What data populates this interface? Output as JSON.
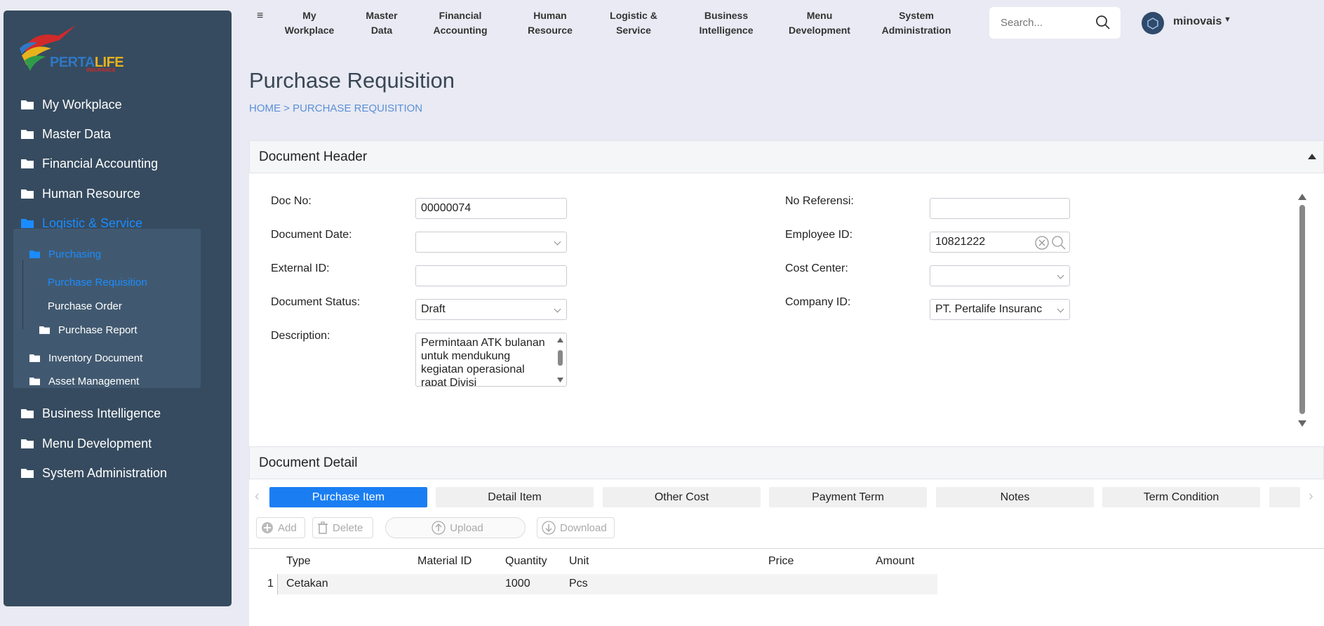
{
  "logo": {
    "brand_part1": "PERTA",
    "brand_part2": "LIFE",
    "tagline": "INSURANCE"
  },
  "sidebar": {
    "items": [
      {
        "label": "My Workplace"
      },
      {
        "label": "Master Data"
      },
      {
        "label": "Financial Accounting"
      },
      {
        "label": "Human Resource"
      },
      {
        "label": "Logistic & Service"
      },
      {
        "label": "Business Intelligence"
      },
      {
        "label": "Menu Development"
      },
      {
        "label": "System Administration"
      }
    ],
    "sub": {
      "purchasing": "Purchasing",
      "purchase_requisition": "Purchase Requisition",
      "purchase_order": "Purchase Order",
      "purchase_report": "Purchase Report",
      "inventory_document": "Inventory Document",
      "asset_management": "Asset Management"
    }
  },
  "topnav": {
    "items": [
      {
        "line1": "My",
        "line2": "Workplace"
      },
      {
        "line1": "Master",
        "line2": "Data"
      },
      {
        "line1": "Financial",
        "line2": "Accounting"
      },
      {
        "line1": "Human",
        "line2": "Resource"
      },
      {
        "line1": "Logistic &",
        "line2": "Service"
      },
      {
        "line1": "Business",
        "line2": "Intelligence"
      },
      {
        "line1": "Menu",
        "line2": "Development"
      },
      {
        "line1": "System",
        "line2": "Administration"
      }
    ],
    "search_placeholder": "Search...",
    "username": "minovais"
  },
  "page": {
    "title": "Purchase Requisition",
    "breadcrumb": "HOME  >  PURCHASE REQUISITION"
  },
  "document_header": {
    "title": "Document Header",
    "doc_no_label": "Doc No:",
    "doc_no_value": "00000074",
    "document_date_label": "Document Date:",
    "document_date_value": "",
    "external_id_label": "External ID:",
    "external_id_value": "",
    "document_status_label": "Document Status:",
    "document_status_value": "Draft",
    "description_label": "Description:",
    "description_value": "Permintaan ATK bulanan untuk mendukung kegiatan operasional rapat Divisi",
    "no_referensi_label": "No Referensi:",
    "no_referensi_value": "",
    "employee_id_label": "Employee ID:",
    "employee_id_value": "10821222",
    "cost_center_label": "Cost Center:",
    "cost_center_value": "",
    "company_id_label": "Company ID:",
    "company_id_value": "PT. Pertalife Insuranc"
  },
  "document_detail": {
    "title": "Document Detail",
    "tabs": [
      "Purchase Item",
      "Detail Item",
      "Other Cost",
      "Payment Term",
      "Notes",
      "Term Condition"
    ],
    "toolbar": {
      "add": "Add",
      "delete": "Delete",
      "upload": "Upload",
      "download": "Download"
    },
    "columns": [
      "Type",
      "Material ID",
      "Quantity",
      "Unit",
      "Price",
      "Amount"
    ],
    "rows": [
      {
        "num": "1",
        "type": "Cetakan",
        "material_id": "",
        "quantity": "1000",
        "unit": "Pcs",
        "price": "",
        "amount": ""
      }
    ]
  },
  "colors": {
    "sidebar": "#364b5f",
    "accent": "#1a7ef2",
    "background": "#e9eaf3"
  }
}
